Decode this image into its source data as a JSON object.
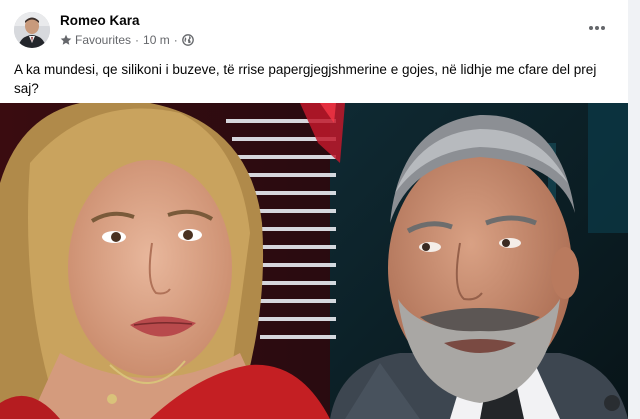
{
  "post": {
    "author": "Romeo Kara",
    "audience": "Favourites",
    "time": "10 m",
    "separator": "·",
    "body": "A ka mundesi, qe silikoni i buzeve, të rrise papergjegjshmerine e gojes, në lidhje me cfare del prej saj?"
  },
  "icons": {
    "favourites": "star-icon",
    "audience": "globe-icon",
    "menu": "more-horizontal-icon"
  },
  "colors": {
    "meta_text": "#65676b",
    "text": "#050505",
    "card": "#ffffff",
    "page": "#f0f2f5"
  }
}
